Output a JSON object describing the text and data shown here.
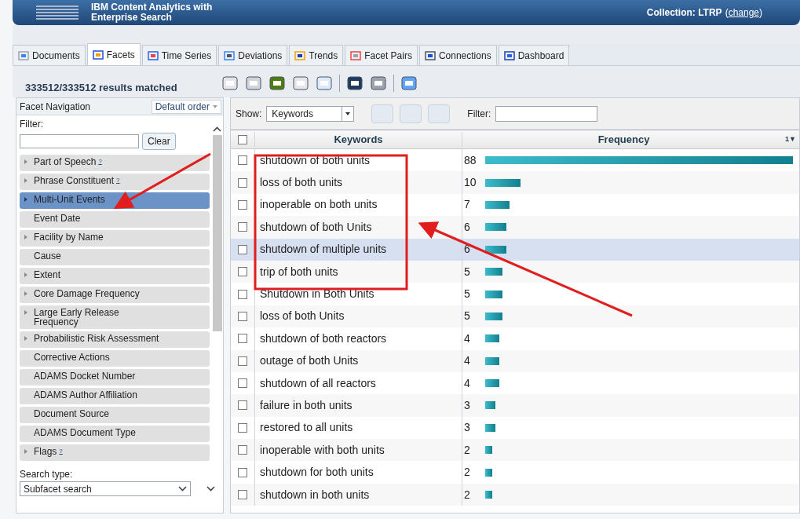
{
  "header": {
    "product_line1": "IBM Content Analytics with",
    "product_line2": "Enterprise Search",
    "collection_label": "Collection: LTRP",
    "paren_open": "(",
    "change_link": "change",
    "paren_close": ")"
  },
  "tabs": [
    {
      "label": "Documents",
      "selected": false
    },
    {
      "label": "Facets",
      "selected": true
    },
    {
      "label": "Time Series",
      "selected": false
    },
    {
      "label": "Deviations",
      "selected": false
    },
    {
      "label": "Trends",
      "selected": false
    },
    {
      "label": "Facet Pairs",
      "selected": false
    },
    {
      "label": "Connections",
      "selected": false
    },
    {
      "label": "Dashboard",
      "selected": false
    }
  ],
  "results_matched": "333512/333512 results matched",
  "facet_navigation": {
    "title": "Facet Navigation",
    "order": "Default order",
    "filter_label": "Filter:",
    "clear_button": "Clear",
    "items": [
      {
        "label": "Part of Speech",
        "help": "?",
        "expandable": true,
        "selected": false
      },
      {
        "label": "Phrase Constituent",
        "help": "?",
        "expandable": true,
        "selected": false
      },
      {
        "label": "Multi-Unit Events",
        "expandable": true,
        "selected": true
      },
      {
        "label": "Event Date",
        "expandable": false,
        "selected": false
      },
      {
        "label": "Facility by Name",
        "expandable": true,
        "selected": false
      },
      {
        "label": "Cause",
        "expandable": false,
        "selected": false
      },
      {
        "label": "Extent",
        "expandable": true,
        "selected": false
      },
      {
        "label": "Core Damage Frequency",
        "expandable": true,
        "selected": false
      },
      {
        "label": "Large Early Release Frequency",
        "expandable": true,
        "selected": false
      },
      {
        "label": "Probabilistic Risk Assessment",
        "expandable": true,
        "selected": false
      },
      {
        "label": "Corrective Actions",
        "expandable": false,
        "selected": false
      },
      {
        "label": "ADAMS Docket Number",
        "expandable": false,
        "selected": false
      },
      {
        "label": "ADAMS Author Affiliation",
        "expandable": false,
        "selected": false
      },
      {
        "label": "Document Source",
        "expandable": false,
        "selected": false
      },
      {
        "label": "ADAMS Document Type",
        "expandable": false,
        "selected": false
      },
      {
        "label": "Flags",
        "help": "?",
        "expandable": true,
        "selected": false
      }
    ],
    "search_type_label": "Search type:",
    "search_type": "Subfacet search"
  },
  "results_toolbar": {
    "show_label": "Show:",
    "show_value": "Keywords",
    "filter_label": "Filter:"
  },
  "table": {
    "columns": [
      "Keywords",
      "Frequency"
    ],
    "sort_indicator": "1▼",
    "all_checked": false,
    "rows": [
      {
        "keyword": "shutdown of both units",
        "frequency": "88",
        "checked": false,
        "selected": false
      },
      {
        "keyword": "loss of both units",
        "frequency": "10",
        "checked": false,
        "selected": false
      },
      {
        "keyword": "inoperable on both units",
        "frequency": "7",
        "checked": false,
        "selected": false
      },
      {
        "keyword": "shutdown of both Units",
        "frequency": "6",
        "checked": false,
        "selected": false
      },
      {
        "keyword": "shutdown of multiple units",
        "frequency": "6",
        "checked": false,
        "selected": true
      },
      {
        "keyword": "trip of both units",
        "frequency": "5",
        "checked": false,
        "selected": false
      },
      {
        "keyword": "Shutdown in Both Units",
        "frequency": "5",
        "checked": false,
        "selected": false
      },
      {
        "keyword": "loss of both Units",
        "frequency": "5",
        "checked": false,
        "selected": false
      },
      {
        "keyword": "shutdown of both reactors",
        "frequency": "4",
        "checked": false,
        "selected": false
      },
      {
        "keyword": "outage of both Units",
        "frequency": "4",
        "checked": false,
        "selected": false
      },
      {
        "keyword": "shutdown of all reactors",
        "frequency": "4",
        "checked": false,
        "selected": false
      },
      {
        "keyword": "failure in both units",
        "frequency": "3",
        "checked": false,
        "selected": false
      },
      {
        "keyword": "restored to all units",
        "frequency": "3",
        "checked": false,
        "selected": false
      },
      {
        "keyword": "inoperable with both units",
        "frequency": "2",
        "checked": false,
        "selected": false
      },
      {
        "keyword": "shutdown for both units",
        "frequency": "2",
        "checked": false,
        "selected": false
      },
      {
        "keyword": "shutdown in both units",
        "frequency": "2",
        "checked": false,
        "selected": false
      }
    ]
  }
}
